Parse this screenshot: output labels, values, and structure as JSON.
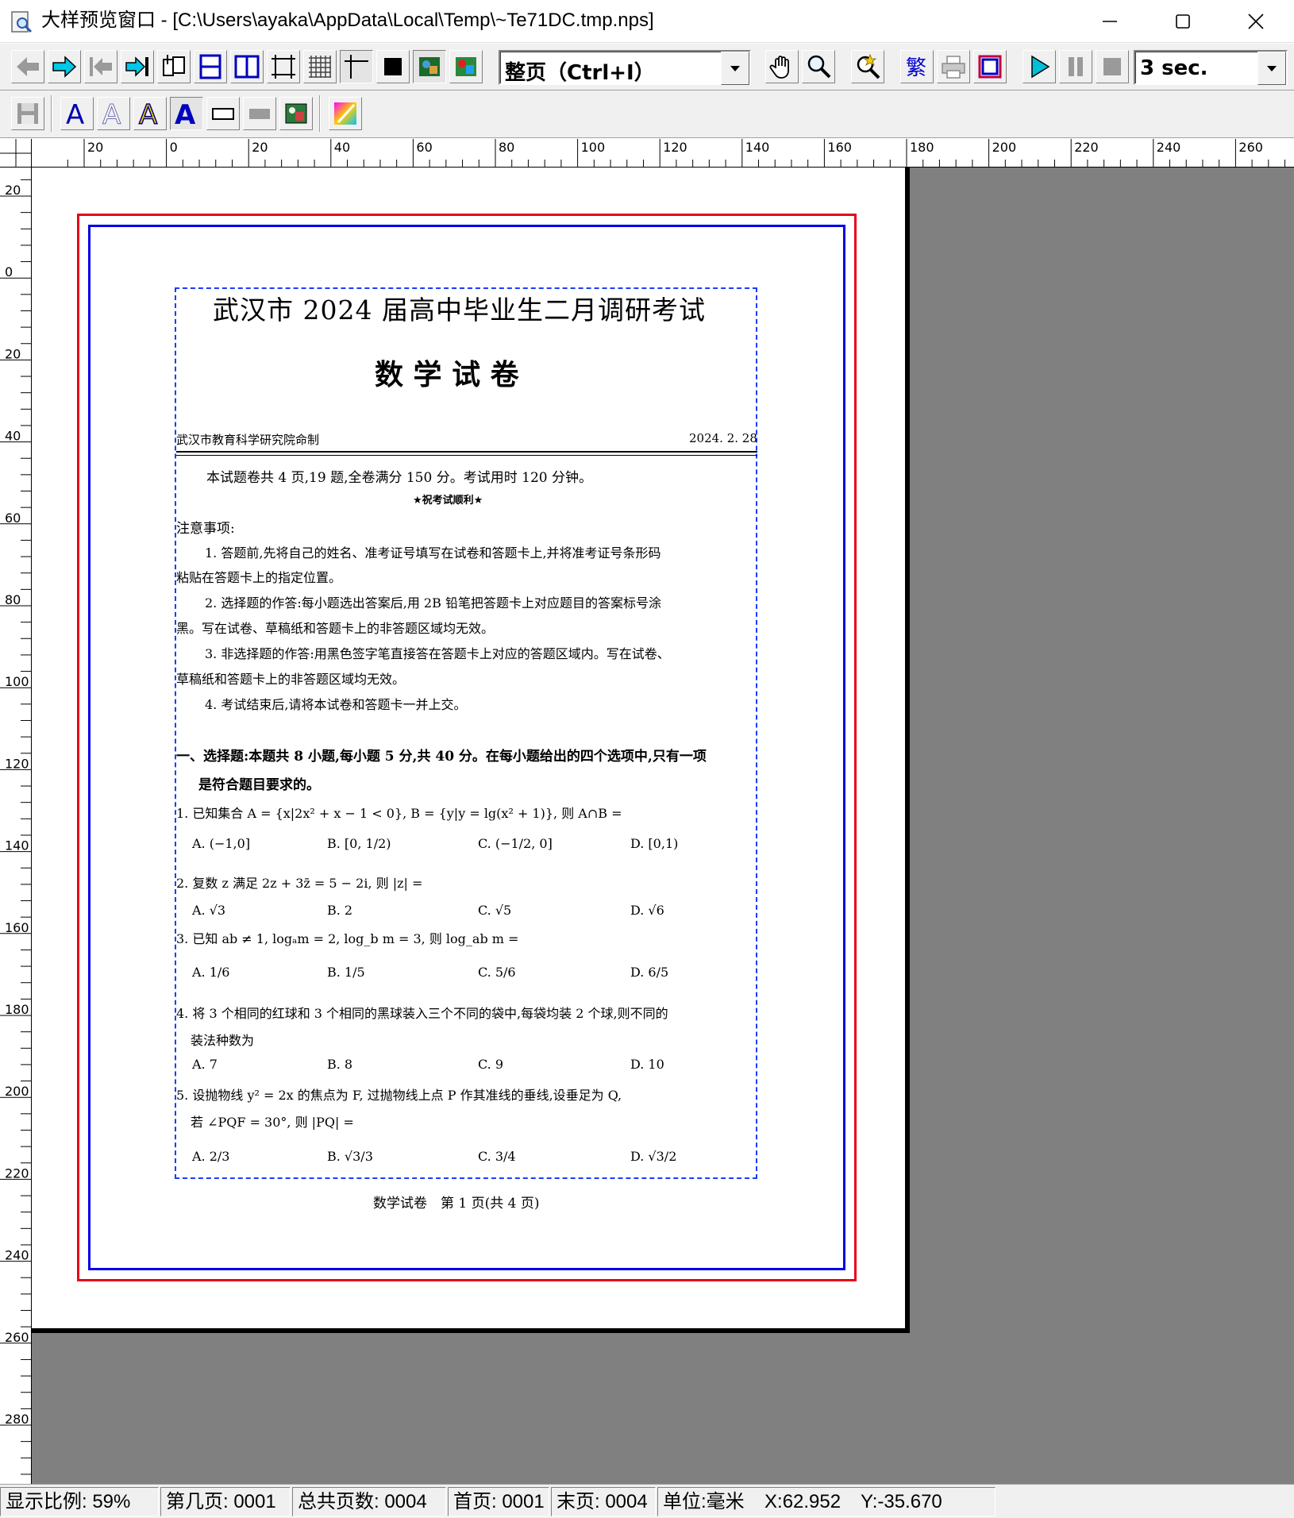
{
  "window": {
    "title": "大样预览窗口 - [C:\\Users\\ayaka\\AppData\\Local\\Temp\\~Te71DC.tmp.nps]",
    "minimize": "—",
    "maximize": "☐",
    "close": "✕"
  },
  "toolbar": {
    "zoom_mode": "整页（Ctrl+I）",
    "autoplay_interval": "3 sec."
  },
  "ruler": {
    "h_labels": [
      "20",
      "0",
      "20",
      "40",
      "60",
      "80",
      "100",
      "120",
      "140",
      "160",
      "180",
      "200",
      "220",
      "240",
      "260"
    ],
    "v_labels": [
      "20",
      "0",
      "20",
      "40",
      "60",
      "80",
      "100",
      "120",
      "140",
      "160",
      "180",
      "200",
      "220",
      "240",
      "260",
      "280"
    ]
  },
  "document": {
    "title": "武汉市 2024 届高中毕业生二月调研考试",
    "subtitle": "数 学 试 卷",
    "issuer": "武汉市教育科学研究院命制",
    "date": "2024. 2. 28",
    "intro": "本试题卷共 4 页,19 题,全卷满分 150 分。考试用时 120 分钟。",
    "wish": "★祝考试顺利★",
    "notes_title": "注意事项:",
    "notes": [
      "1. 答题前,先将自己的姓名、准考证号填写在试卷和答题卡上,并将准考证号条形码",
      "粘贴在答题卡上的指定位置。",
      "2. 选择题的作答:每小题选出答案后,用 2B 铅笔把答题卡上对应题目的答案标号涂",
      "黑。写在试卷、草稿纸和答题卡上的非答题区域均无效。",
      "3. 非选择题的作答:用黑色签字笔直接答在答题卡上对应的答题区域内。写在试卷、",
      "草稿纸和答题卡上的非答题区域均无效。",
      "4. 考试结束后,请将本试卷和答题卡一并上交。"
    ],
    "section1_line1": "一、选择题:本题共 8 小题,每小题 5 分,共 40 分。在每小题给出的四个选项中,只有一项",
    "section1_line2": "是符合题目要求的。",
    "questions": [
      {
        "stem": "1. 已知集合 A = {x|2x² + x − 1 < 0}, B = {y|y = lg(x² + 1)}, 则 A∩B =",
        "options": [
          "A. (−1,0]",
          "B. [0, 1/2)",
          "C. (−1/2, 0]",
          "D. [0,1)"
        ]
      },
      {
        "stem": "2. 复数 z 满足 2z + 3z̄ = 5 − 2i, 则 |z| =",
        "options": [
          "A. √3",
          "B. 2",
          "C. √5",
          "D. √6"
        ]
      },
      {
        "stem": "3. 已知 ab ≠ 1, logₐm = 2, log_b m = 3, 则 log_ab m =",
        "options": [
          "A. 1/6",
          "B. 1/5",
          "C. 5/6",
          "D. 6/5"
        ]
      },
      {
        "stem": "4. 将 3 个相同的红球和 3 个相同的黑球装入三个不同的袋中,每袋均装 2 个球,则不同的",
        "stem2": "装法种数为",
        "options": [
          "A. 7",
          "B. 8",
          "C. 9",
          "D. 10"
        ]
      },
      {
        "stem": "5. 设抛物线 y² = 2x 的焦点为 F, 过抛物线上点 P 作其准线的垂线,设垂足为 Q,",
        "stem2": "若 ∠PQF = 30°, 则 |PQ| =",
        "options": [
          "A. 2/3",
          "B. √3/3",
          "C. 3/4",
          "D. √3/2"
        ]
      }
    ],
    "footer": "数学试卷　第 1 页(共 4 页)"
  },
  "status": {
    "zoom": "显示比例: 59%",
    "current_page": "第几页: 0001",
    "total_pages": "总共页数: 0004",
    "first_page": "首页: 0001",
    "last_page": "末页: 0004",
    "unit": "单位:毫米",
    "x": "X:62.952",
    "y": "Y:-35.670"
  },
  "colors": {
    "outer_frame": "#e8001c",
    "inner_frame": "#0000e6",
    "print_area": "#1a3cff",
    "workspace": "#808080"
  }
}
